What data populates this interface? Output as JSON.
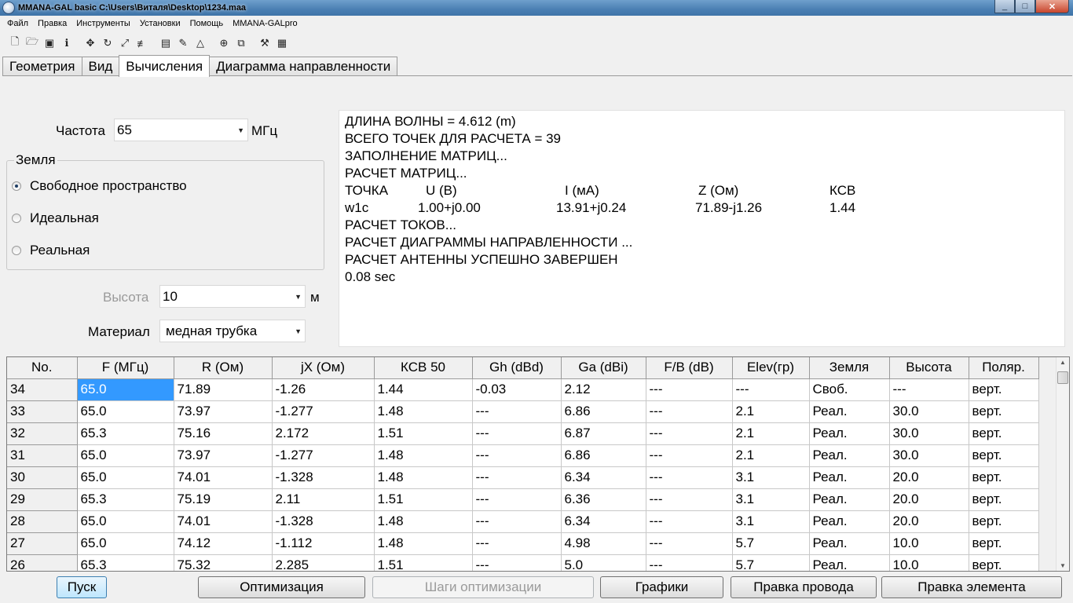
{
  "window": {
    "title": "MMANA-GAL basic C:\\Users\\Виталя\\Desktop\\1234.maa",
    "min": "_",
    "max": "□",
    "close": "✕"
  },
  "menu": [
    "Файл",
    "Правка",
    "Инструменты",
    "Установки",
    "Помощь",
    "MMANA-GALpro"
  ],
  "toolbar": [
    "new-file-icon",
    "open-folder-icon",
    "save-icon",
    "info-icon",
    "move-icon",
    "rotate-icon",
    "scale-icon",
    "wire-edit-icon",
    "document-icon",
    "comment-icon",
    "triangle-icon",
    "target-icon",
    "copy-icon",
    "tools-icon",
    "calculator-icon"
  ],
  "tabs": [
    "Геометрия",
    "Вид",
    "Вычисления",
    "Диаграмма направленности"
  ],
  "calc": {
    "freq_label": "Частота",
    "freq_value": "65",
    "freq_unit": "МГц",
    "ground_title": "Земля",
    "ground_options": [
      "Свободное пространство",
      "Идеальная",
      "Реальная"
    ],
    "height_label": "Высота",
    "height_value": "10",
    "height_unit": "м",
    "material_label": "Материал",
    "material_value": "медная трубка"
  },
  "log": {
    "lines_top": [
      "ДЛИНА ВОЛНЫ = 4.612 (m)",
      "ВСЕГО ТОЧЕК ДЛЯ РАСЧЕТА = 39",
      "ЗАПОЛНЕНИЕ МАТРИЦ...",
      "РАСЧЕТ МАТРИЦ..."
    ],
    "header": [
      "ТОЧКА",
      "U (B)",
      "I (мА)",
      "Z (Ом)",
      "КСВ"
    ],
    "row": [
      "w1c",
      "1.00+j0.00",
      "13.91+j0.24",
      "71.89-j1.26",
      "1.44"
    ],
    "lines_bottom": [
      "РАСЧЕТ ТОКОВ...",
      "РАСЧЕТ ДИАГРАММЫ НАПРАВЛЕННОСТИ ...",
      "РАСЧЕТ АНТЕННЫ УСПЕШНО ЗАВЕРШЕН",
      "0.08 sec"
    ]
  },
  "table": {
    "columns": [
      "No.",
      "F (МГц)",
      "R (Ом)",
      "jX (Ом)",
      "КСВ 50",
      "Gh (dBd)",
      "Ga (dBi)",
      "F/B (dB)",
      "Elev(гр)",
      "Земля",
      "Высота",
      "Поляр."
    ],
    "rows": [
      [
        "34",
        "65.0",
        "71.89",
        "-1.26",
        "1.44",
        "-0.03",
        "2.12",
        "---",
        " ---",
        "Своб.",
        " ---",
        "верт."
      ],
      [
        "33",
        "65.0",
        "73.97",
        "-1.277",
        "1.48",
        "---",
        "6.86",
        "---",
        "2.1",
        "Реал.",
        "30.0",
        "верт."
      ],
      [
        "32",
        "65.3",
        "75.16",
        "2.172",
        "1.51",
        "---",
        "6.87",
        "---",
        "2.1",
        "Реал.",
        "30.0",
        "верт."
      ],
      [
        "31",
        "65.0",
        "73.97",
        "-1.277",
        "1.48",
        "---",
        "6.86",
        "---",
        "2.1",
        "Реал.",
        "30.0",
        "верт."
      ],
      [
        "30",
        "65.0",
        "74.01",
        "-1.328",
        "1.48",
        "---",
        "6.34",
        "---",
        "3.1",
        "Реал.",
        "20.0",
        "верт."
      ],
      [
        "29",
        "65.3",
        "75.19",
        "2.11",
        "1.51",
        "---",
        "6.36",
        "---",
        "3.1",
        "Реал.",
        "20.0",
        "верт."
      ],
      [
        "28",
        "65.0",
        "74.01",
        "-1.328",
        "1.48",
        "---",
        "6.34",
        "---",
        "3.1",
        "Реал.",
        "20.0",
        "верт."
      ],
      [
        "27",
        "65.0",
        "74.12",
        "-1.112",
        "1.48",
        "---",
        "4.98",
        "---",
        "5.7",
        "Реал.",
        "10.0",
        "верт."
      ],
      [
        "26",
        "65.3",
        "75.32",
        "2.285",
        "1.51",
        "---",
        "5.0",
        "---",
        "5.7",
        "Реал.",
        "10.0",
        "верт."
      ]
    ]
  },
  "buttons": [
    "Пуск",
    "Оптимизация",
    "Шаги оптимизации",
    "Графики",
    "Правка провода",
    "Правка элемента"
  ]
}
